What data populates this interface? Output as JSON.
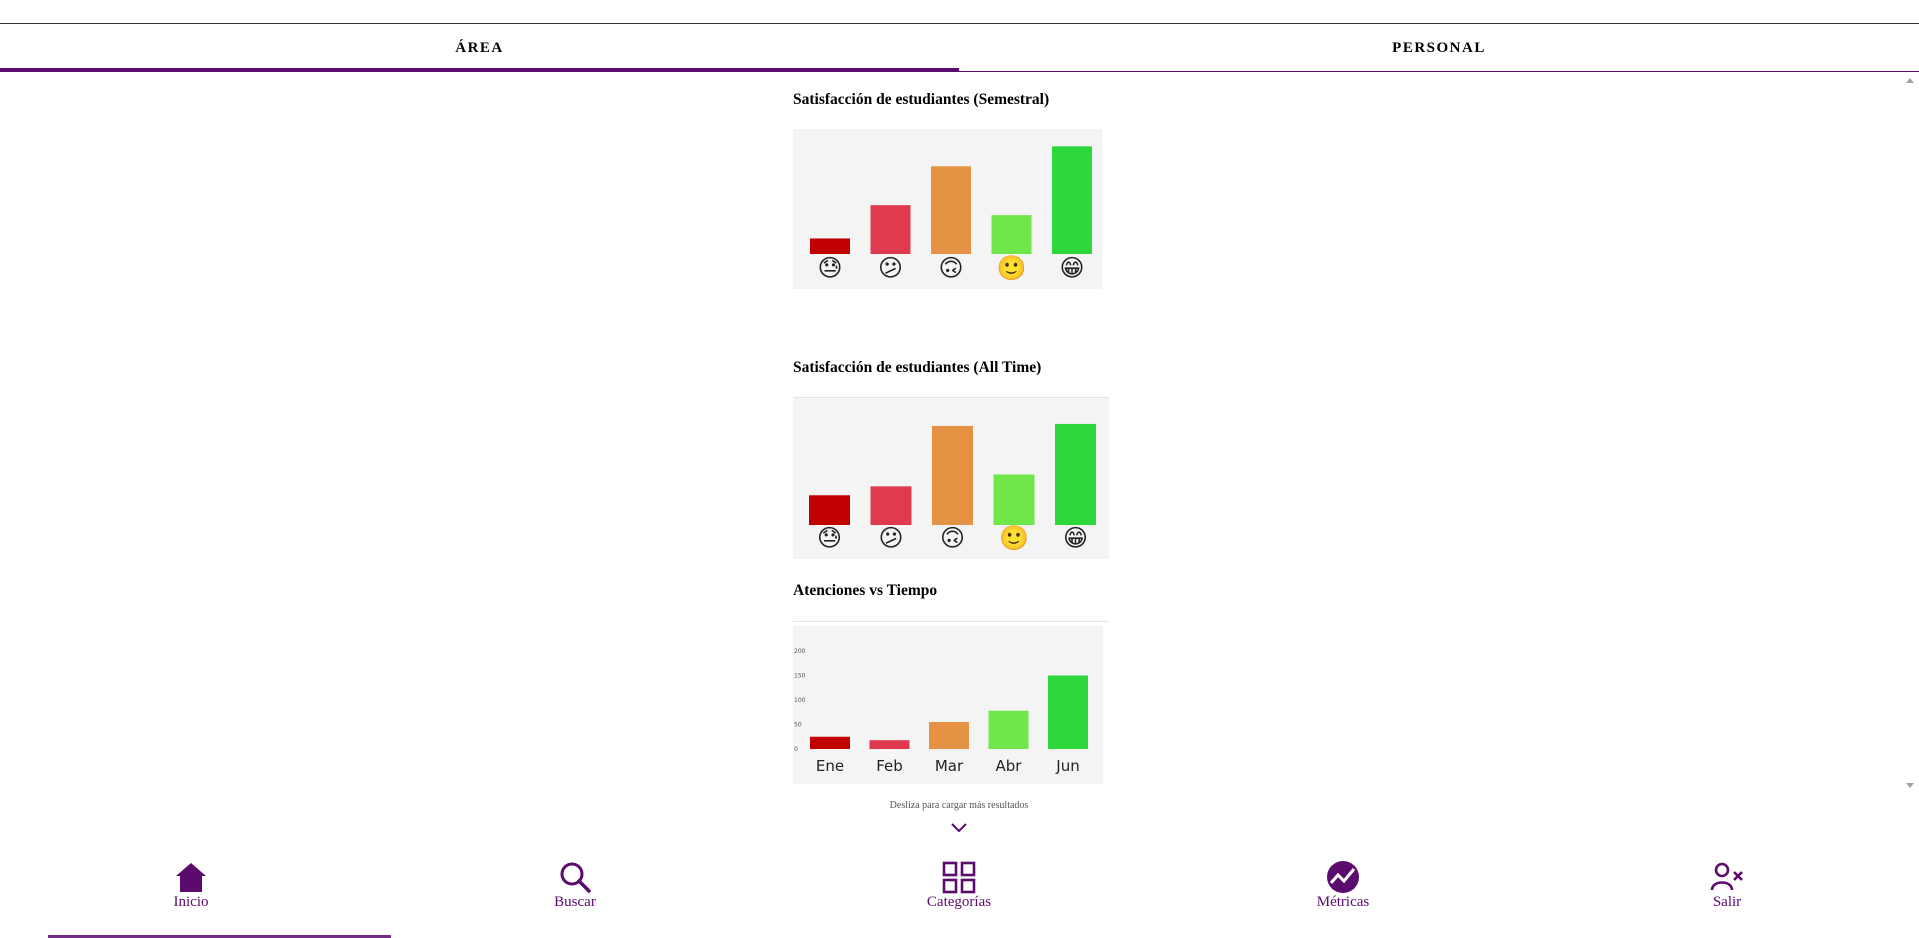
{
  "tabs": [
    {
      "label": "ÁREA",
      "active": true
    },
    {
      "label": "PERSONAL",
      "active": false
    }
  ],
  "sections": [
    {
      "title": "Satisfacción de estudiantes (Semestral)"
    },
    {
      "title": "Satisfacción de estudiantes (All Time)"
    },
    {
      "title": "Atenciones vs Tiempo"
    }
  ],
  "chart_data": [
    {
      "type": "bar",
      "categories": [
        "😓",
        "😕",
        "🙃",
        "🙂",
        "😁"
      ],
      "values": [
        14,
        44,
        79,
        35,
        97
      ],
      "ylim": [
        0,
        100
      ],
      "colors": [
        "#c00000",
        "#e03a4e",
        "#e69244",
        "#6fe64a",
        "#2ed73b"
      ],
      "grid": false
    },
    {
      "type": "bar",
      "categories": [
        "😓",
        "😕",
        "🙃",
        "🙂",
        "😁"
      ],
      "values": [
        30,
        39,
        100,
        51,
        102
      ],
      "ylim": [
        0,
        110
      ],
      "colors": [
        "#c00000",
        "#e03a4e",
        "#e69244",
        "#6fe64a",
        "#2ed73b"
      ],
      "grid": false
    },
    {
      "type": "bar",
      "categories": [
        "Ene",
        "Feb",
        "Mar",
        "Abr",
        "Jun"
      ],
      "values": [
        25,
        18,
        55,
        78,
        150
      ],
      "yticks": [
        0,
        50,
        100,
        150,
        200
      ],
      "ylim": [
        0,
        200
      ],
      "colors": [
        "#c00000",
        "#e03a4e",
        "#e69244",
        "#6fe64a",
        "#2ed73b"
      ],
      "grid": false
    }
  ],
  "hint": "Desliza para cargar más resultados",
  "nav": [
    {
      "label": "Inicio",
      "icon": "home-icon"
    },
    {
      "label": "Buscar",
      "icon": "search-icon"
    },
    {
      "label": "Categorías",
      "icon": "grid-icon"
    },
    {
      "label": "Métricas",
      "icon": "metrics-icon"
    },
    {
      "label": "Salir",
      "icon": "user-remove-icon"
    }
  ],
  "colors": {
    "accent": "#5b0a6e"
  }
}
